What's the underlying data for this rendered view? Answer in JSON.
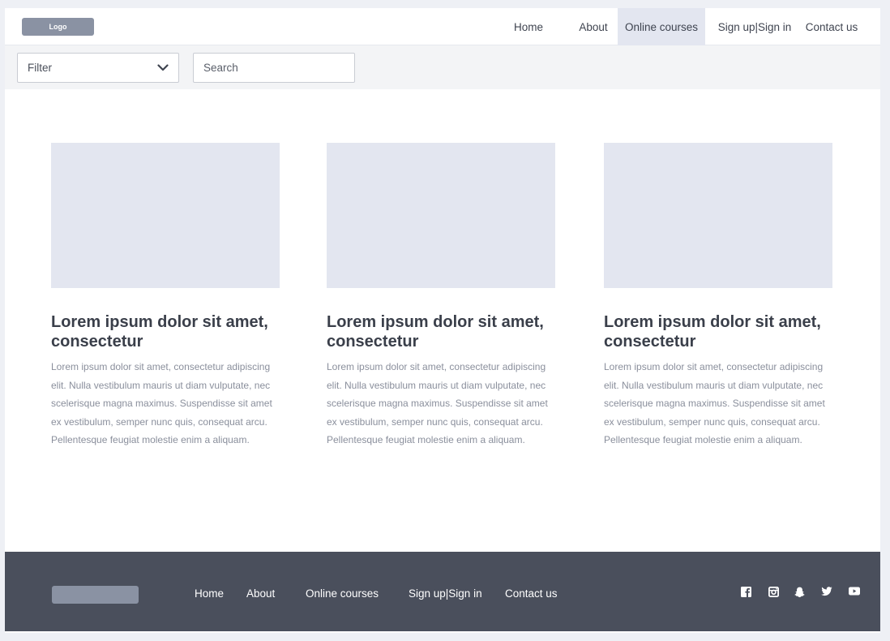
{
  "header": {
    "logo_label": "Logo",
    "nav": [
      {
        "label": "Home",
        "active": false
      },
      {
        "label": "About",
        "active": false
      },
      {
        "label": "Online courses",
        "active": true
      },
      {
        "label": "Sign up|Sign in",
        "active": false
      },
      {
        "label": "Contact us",
        "active": false
      }
    ]
  },
  "filterbar": {
    "filter_label": "Filter",
    "search_placeholder": "Search"
  },
  "cards": [
    {
      "title": "Lorem ipsum dolor sit amet, consectetur",
      "text": "Lorem ipsum dolor sit amet, consectetur adipiscing elit. Nulla vestibulum mauris ut diam vulputate, nec scelerisque magna maximus. Suspendisse sit amet ex vestibulum, semper nunc quis, consequat arcu. Pellentesque feugiat molestie enim a aliquam."
    },
    {
      "title": "Lorem ipsum dolor sit amet, consectetur",
      "text": "Lorem ipsum dolor sit amet, consectetur adipiscing elit. Nulla vestibulum mauris ut diam vulputate, nec scelerisque magna maximus. Suspendisse sit amet ex vestibulum, semper nunc quis, consequat arcu. Pellentesque feugiat molestie enim a aliquam."
    },
    {
      "title": "Lorem ipsum dolor sit amet, consectetur",
      "text": "Lorem ipsum dolor sit amet, consectetur adipiscing elit. Nulla vestibulum mauris ut diam vulputate, nec scelerisque magna maximus. Suspendisse sit amet ex vestibulum, semper nunc quis, consequat arcu. Pellentesque feugiat molestie enim a aliquam."
    }
  ],
  "footer": {
    "nav": [
      {
        "label": "Home"
      },
      {
        "label": "About"
      },
      {
        "label": "Online courses"
      },
      {
        "label": "Sign up|Sign in"
      },
      {
        "label": "Contact us"
      }
    ],
    "social_icons": [
      "facebook-icon",
      "instagram-icon",
      "snapchat-icon",
      "twitter-icon",
      "youtube-icon"
    ]
  },
  "colors": {
    "page_background": "#eef0f5",
    "active_nav": "#e3e6f0",
    "image_placeholder": "#e3e6f0",
    "footer_background": "#4a4f5c",
    "logo_placeholder": "#8a92a3"
  }
}
